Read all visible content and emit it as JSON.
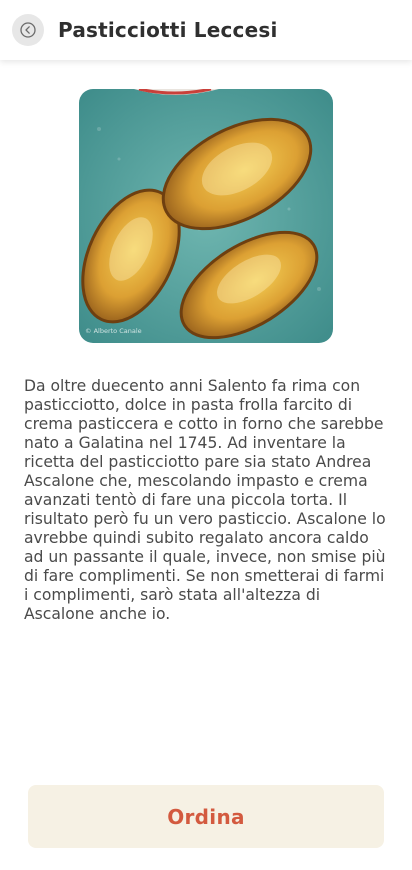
{
  "header": {
    "back_icon": "back-arrow-circle-icon",
    "title": "Pasticciotti Leccesi"
  },
  "hero_image": {
    "watermark": "© Alberto Canale"
  },
  "description": "Da oltre duecento anni Salento fa rima con pasticciotto, dolce in pasta frolla farcito di crema pasticcera e cotto in forno che sarebbe nato a Galatina nel 1745. Ad inventare la ricetta del pasticciotto pare sia stato Andrea Ascalone che, mescolando impasto e crema avanzati tentò di fare una piccola torta. Il risultato però fu un vero pasticcio. Ascalone lo avrebbe quindi subito regalato ancora caldo ad un passante il quale, invece, non smise più di fare complimenti. Se non smetterai di farmi i complimenti, sarò stata all'altezza di Ascalone anche io.",
  "actions": {
    "order_label": "Ordina"
  },
  "colors": {
    "accent": "#d35a3f",
    "button_bg": "#f6f1e4",
    "plate": "#5fa8a3"
  }
}
